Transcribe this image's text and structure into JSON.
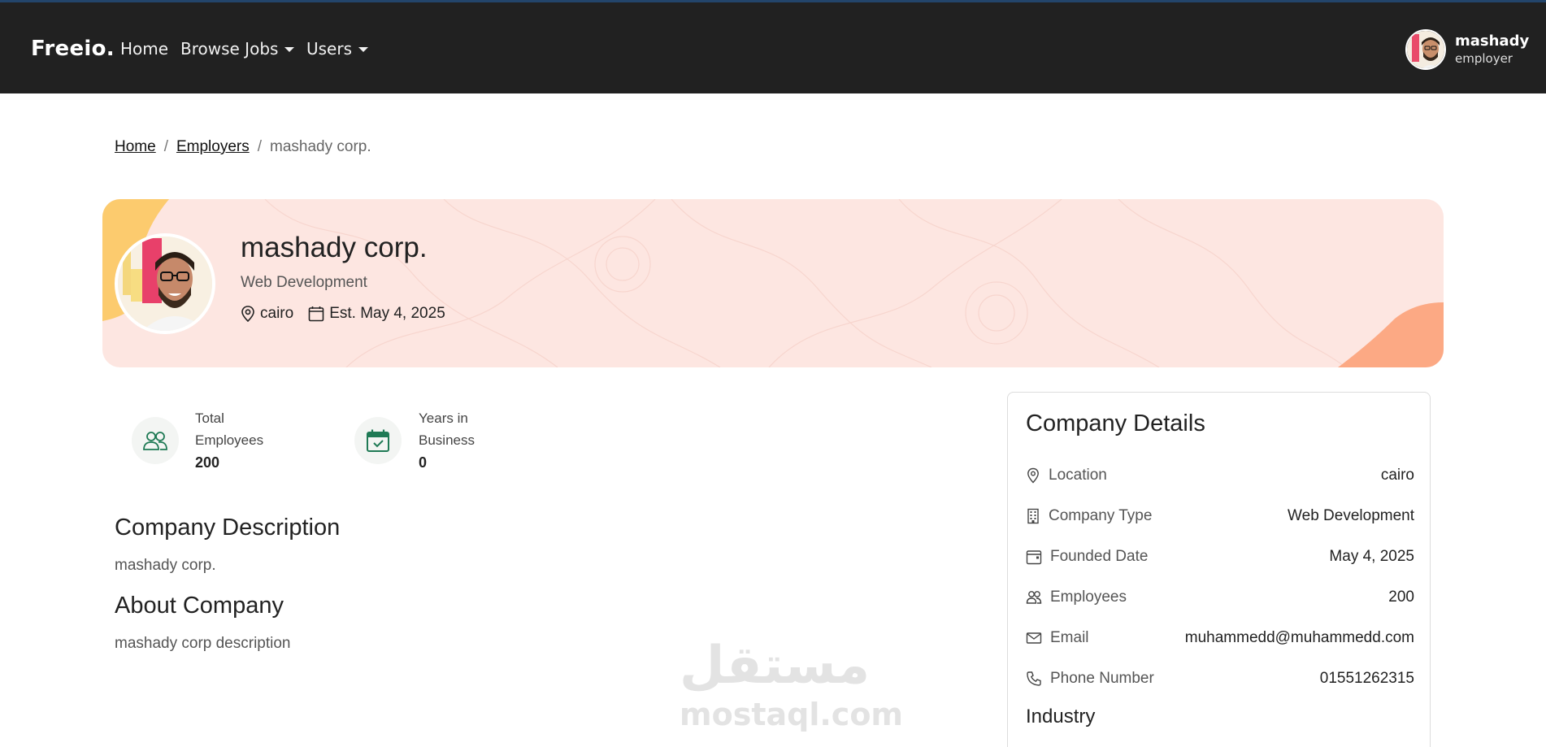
{
  "navbar": {
    "brand": "Freeio.",
    "links": [
      {
        "label": "Home"
      },
      {
        "label": "Browse Jobs"
      },
      {
        "label": "Users"
      }
    ],
    "user": {
      "name": "mashady",
      "role": "employer"
    }
  },
  "breadcrumb": {
    "items": [
      "Home",
      "Employers"
    ],
    "current": "mashady corp.",
    "separator": "/"
  },
  "hero": {
    "name": "mashady corp.",
    "type": "Web Development",
    "location": "cairo",
    "established": "Est. May 4, 2025"
  },
  "stats": [
    {
      "label_line1": "Total",
      "label_line2": "Employees",
      "value": "200",
      "icon": "users-icon"
    },
    {
      "label_line1": "Years in",
      "label_line2": "Business",
      "value": "0",
      "icon": "calendar-check-icon"
    }
  ],
  "description": {
    "title": "Company Description",
    "text": "mashady corp.",
    "about_title": "About Company",
    "about_text": "mashady corp description"
  },
  "details": {
    "title": "Company Details",
    "rows": [
      {
        "label": "Location",
        "value": "cairo",
        "icon": "location-icon"
      },
      {
        "label": "Company Type",
        "value": "Web Development",
        "icon": "building-icon"
      },
      {
        "label": "Founded Date",
        "value": "May 4, 2025",
        "icon": "calendar-icon"
      },
      {
        "label": "Employees",
        "value": "200",
        "icon": "users-icon"
      },
      {
        "label": "Email",
        "value": "muhammedd@muhammedd.com",
        "icon": "envelope-icon"
      },
      {
        "label": "Phone Number",
        "value": "01551262315",
        "icon": "phone-icon"
      }
    ],
    "industry_title": "Industry"
  },
  "watermark": {
    "arabic": "مستقل",
    "latin": "mostaql.com"
  },
  "colors": {
    "navbar": "#212121",
    "hero_bg": "#fde6e1",
    "accent_yellow": "#fccb6e",
    "accent_orange": "#fca984",
    "icon_green": "#1f7a55"
  }
}
